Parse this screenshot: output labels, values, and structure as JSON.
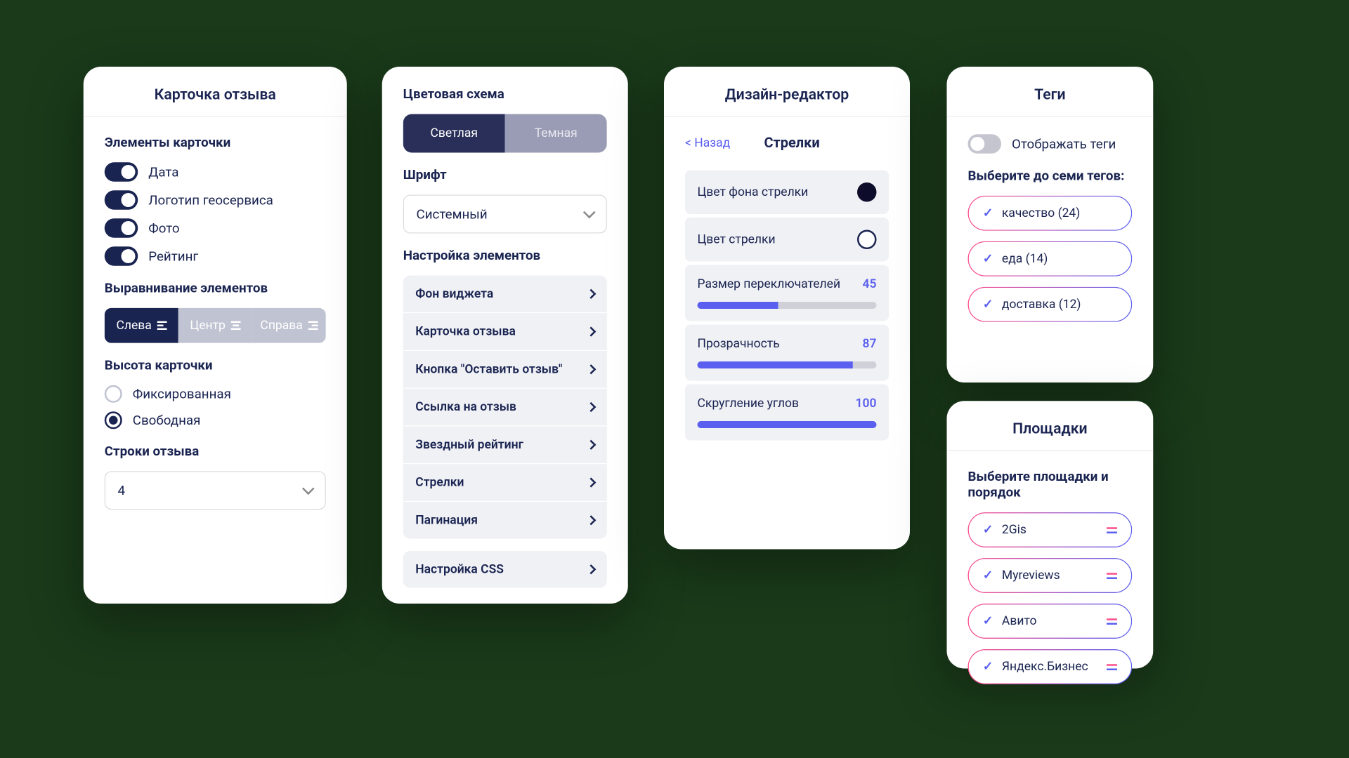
{
  "cardA": {
    "title": "Карточка отзыва",
    "elements_hdr": "Элементы карточки",
    "toggles": [
      "Дата",
      "Логотип геосервиса",
      "Фото",
      "Рейтинг"
    ],
    "align_hdr": "Выравнивание элементов",
    "align": [
      "Слева",
      "Центр",
      "Справа"
    ],
    "height_hdr": "Высота карточки",
    "height_fixed": "Фиксированная",
    "height_free": "Свободная",
    "lines_hdr": "Строки отзыва",
    "lines_val": "4"
  },
  "cardB": {
    "scheme_hdr": "Цветовая схема",
    "scheme_light": "Светлая",
    "scheme_dark": "Темная",
    "font_hdr": "Шрифт",
    "font_val": "Системный",
    "nav_hdr": "Настройка элементов",
    "nav": [
      "Фон виджета",
      "Карточка отзыва",
      "Кнопка \"Оставить отзыв\"",
      "Ссылка на отзыв",
      "Звездный рейтинг",
      "Стрелки",
      "Пагинация"
    ],
    "nav_css": "Настройка CSS"
  },
  "cardC": {
    "title": "Дизайн-редактор",
    "back": "< Назад",
    "sub": "Стрелки",
    "opt_bg": "Цвет фона стрелки",
    "opt_color": "Цвет стрелки",
    "opt_size": "Размер переключателей",
    "opt_size_val": "45",
    "opt_opacity": "Прозрачность",
    "opt_opacity_val": "87",
    "opt_radius": "Скругление углов",
    "opt_radius_val": "100"
  },
  "cardD": {
    "title": "Теги",
    "show": "Отображать теги",
    "pick_hdr": "Выберите до семи тегов:",
    "tags": [
      "качество (24)",
      "еда (14)",
      "доставка (12)"
    ]
  },
  "cardE": {
    "title": "Площадки",
    "pick_hdr": "Выберите площадки и порядок",
    "items": [
      "2Gis",
      "Myreviews",
      "Авито",
      "Яндекс.Бизнес"
    ]
  }
}
